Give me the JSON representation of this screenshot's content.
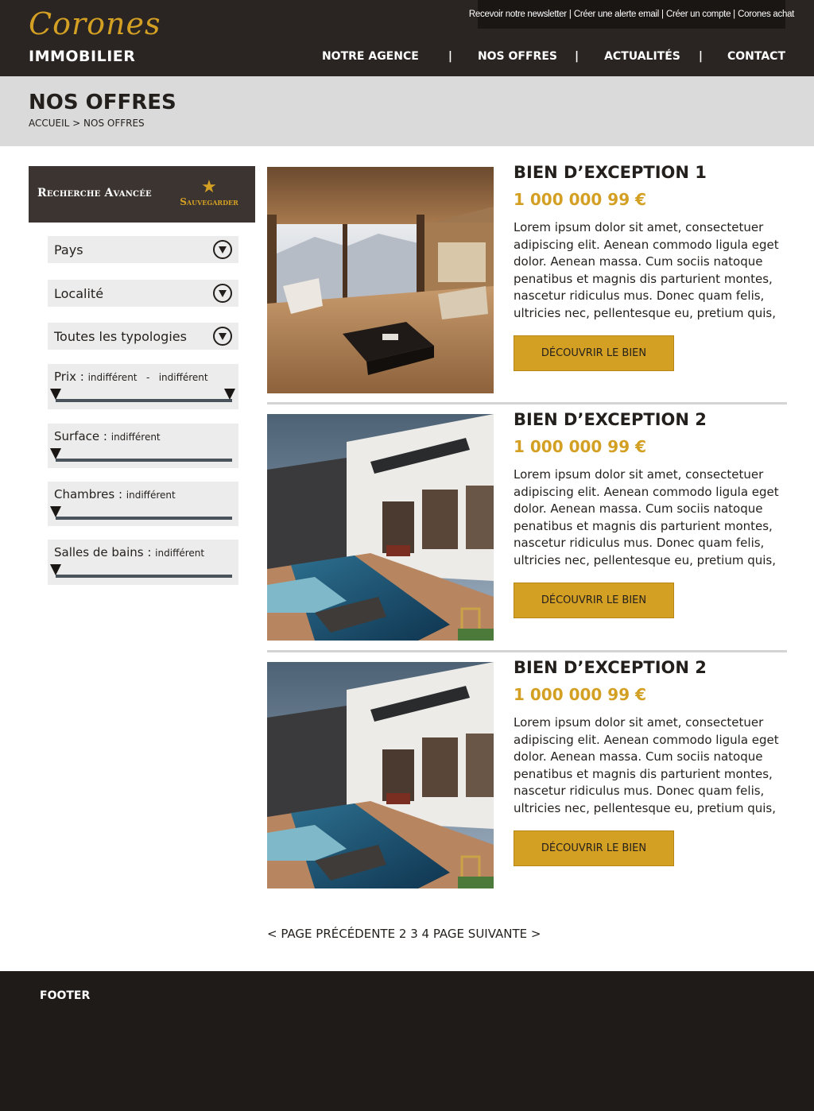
{
  "brand": {
    "logo_script": "Corones",
    "logo_sub": "IMMOBILIER",
    "accent_color": "#d4a024",
    "dark_color": "#2a2522"
  },
  "topbar": {
    "links": [
      "Recevoir notre newsletter",
      "Créer une alerte email",
      "Créer un compte",
      "Corones achat"
    ],
    "separator": "|"
  },
  "nav": {
    "items": [
      "NOTRE AGENCE",
      "NOS OFFRES",
      "ACTUALITÉS",
      "CONTACT"
    ],
    "separator": "|"
  },
  "page": {
    "title": "NOS OFFRES",
    "breadcrumb": "ACCUEIL > NOS OFFRES"
  },
  "sidebar": {
    "title": "Recherche Avancée",
    "save_label": "Sauvegarder",
    "save_icon": "star-icon",
    "selects": [
      {
        "label": "Pays",
        "icon": "chevron-down-circle-icon"
      },
      {
        "label": "Localité",
        "icon": "chevron-down-circle-icon"
      },
      {
        "label": "Toutes les typologies",
        "icon": "chevron-down-circle-icon"
      }
    ],
    "ranges": [
      {
        "label": "Prix : ",
        "value": "indifférent   -   indifférent",
        "handles": 2
      },
      {
        "label": "Surface : ",
        "value": "indifférent",
        "handles": 1
      },
      {
        "label": "Chambres : ",
        "value": "indifférent",
        "handles": 1
      },
      {
        "label": "Salles de bains : ",
        "value": "indifférent",
        "handles": 1
      }
    ]
  },
  "listings": [
    {
      "title": "BIEN D’EXCEPTION 1",
      "price": "1 000 000 99 €",
      "description": "Lorem ipsum dolor sit amet, consectetuer adipiscing elit. Aenean commodo ligula eget dolor. Aenean massa. Cum sociis natoque penatibus et magnis dis parturient montes, nascetur ridiculus mus. Donec quam felis, ultricies nec, pellentesque eu, pretium quis,",
      "button": "DÉCOUVRIR LE BIEN",
      "image": "interior-living-room-photo"
    },
    {
      "title": "BIEN D’EXCEPTION 2",
      "price": "1 000 000 99 €",
      "description": "Lorem ipsum dolor sit amet, consectetuer adipiscing elit. Aenean commodo ligula eget dolor. Aenean massa. Cum sociis natoque penatibus et magnis dis parturient montes, nascetur ridiculus mus. Donec quam felis, ultricies nec, pellentesque eu, pretium quis,",
      "button": "DÉCOUVRIR LE BIEN",
      "image": "villa-pool-photo"
    },
    {
      "title": "BIEN D’EXCEPTION 2",
      "price": "1 000 000 99 €",
      "description": "Lorem ipsum dolor sit amet, consectetuer adipiscing elit. Aenean commodo ligula eget dolor. Aenean massa. Cum sociis natoque penatibus et magnis dis parturient montes, nascetur ridiculus mus. Donec quam felis, ultricies nec, pellentesque eu, pretium quis,",
      "button": "DÉCOUVRIR LE BIEN",
      "image": "villa-pool-photo"
    }
  ],
  "pagination": {
    "prev": "< PAGE PRÉCÉDENTE",
    "pages": [
      "2",
      "3",
      "4"
    ],
    "next": "PAGE SUIVANTE >"
  },
  "footer": {
    "label": "FOOTER"
  }
}
